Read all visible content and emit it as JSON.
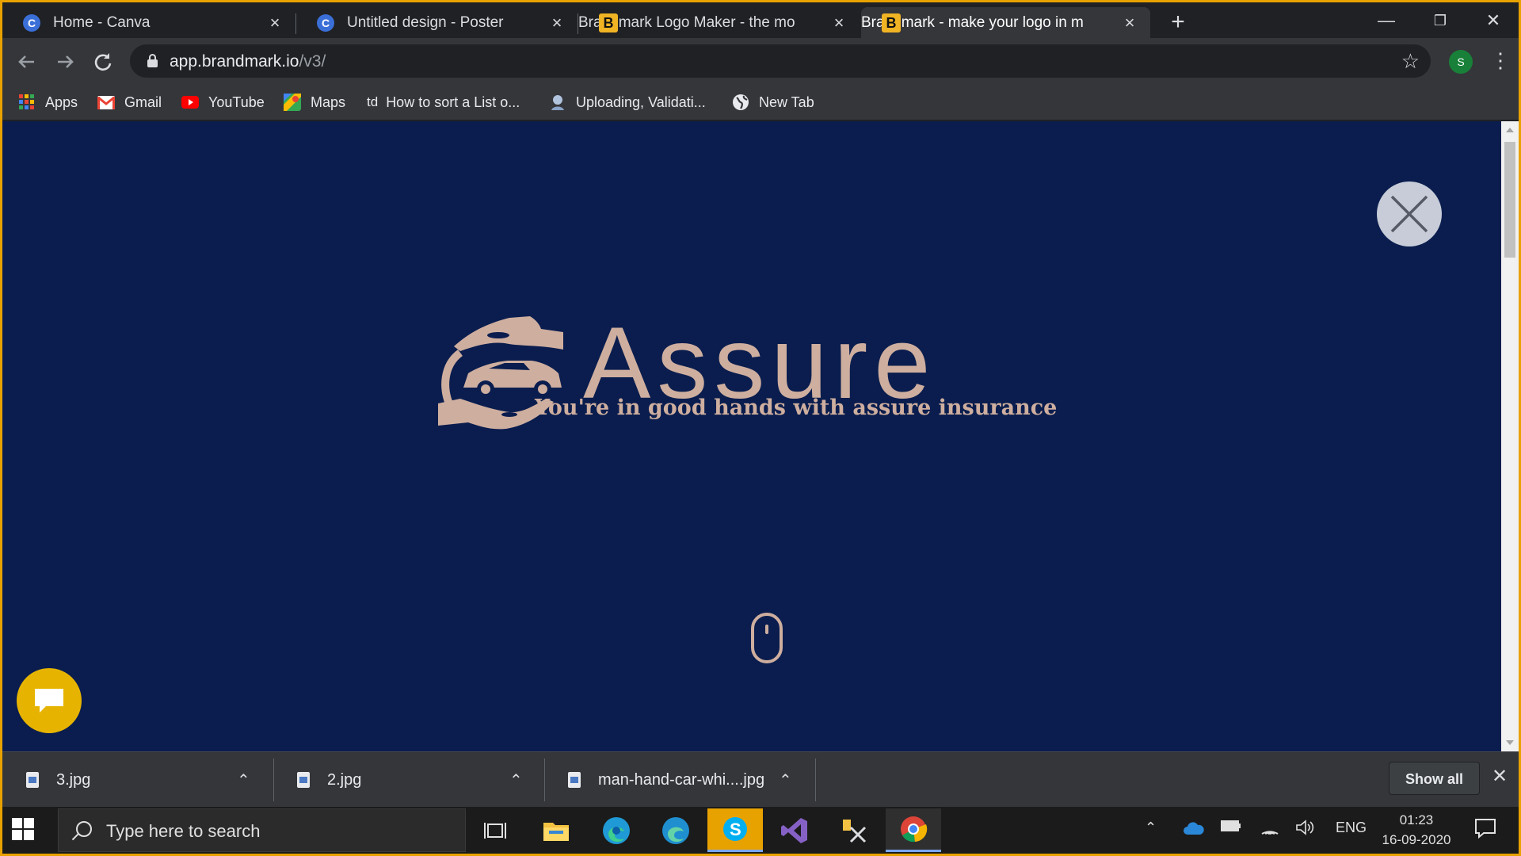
{
  "browser": {
    "tabs": [
      {
        "title": "Home - Canva",
        "favicon": "canva-icon"
      },
      {
        "title": "Untitled design - Poster",
        "favicon": "canva-icon"
      },
      {
        "title": "Brandmark Logo Maker - the mo",
        "favicon": "brandmark-icon"
      },
      {
        "title": "Brandmark - make your logo in m",
        "favicon": "brandmark-icon",
        "active": true
      }
    ],
    "new_tab": "+",
    "window_controls": {
      "minimize": "—",
      "restore": "❐",
      "close": "✕"
    },
    "url_host": "app.brandmark.io",
    "url_path": "/v3/",
    "profile_initial": "S",
    "bookmarks": [
      {
        "label": "Apps",
        "icon": "apps-grid-icon"
      },
      {
        "label": "Gmail",
        "icon": "gmail-icon"
      },
      {
        "label": "YouTube",
        "icon": "youtube-icon"
      },
      {
        "label": "Maps",
        "icon": "maps-icon"
      },
      {
        "label": "How to sort a List o...",
        "icon_text": "td"
      },
      {
        "label": "Uploading, Validati...",
        "icon": "site-icon"
      },
      {
        "label": "New Tab",
        "icon": "globe-icon"
      }
    ]
  },
  "page": {
    "background": "#0a1d4e",
    "accent": "#ceae9f",
    "logo": {
      "brand_name": "Assure",
      "tagline": "You're in good hands with assure insurance"
    }
  },
  "downloads": {
    "items": [
      {
        "name": "3.jpg"
      },
      {
        "name": "2.jpg"
      },
      {
        "name": "man-hand-car-whi....jpg"
      }
    ],
    "show_all": "Show all"
  },
  "taskbar": {
    "search_placeholder": "Type here to search",
    "tray_language": "ENG",
    "time": "01:23",
    "date": "16-09-2020"
  }
}
